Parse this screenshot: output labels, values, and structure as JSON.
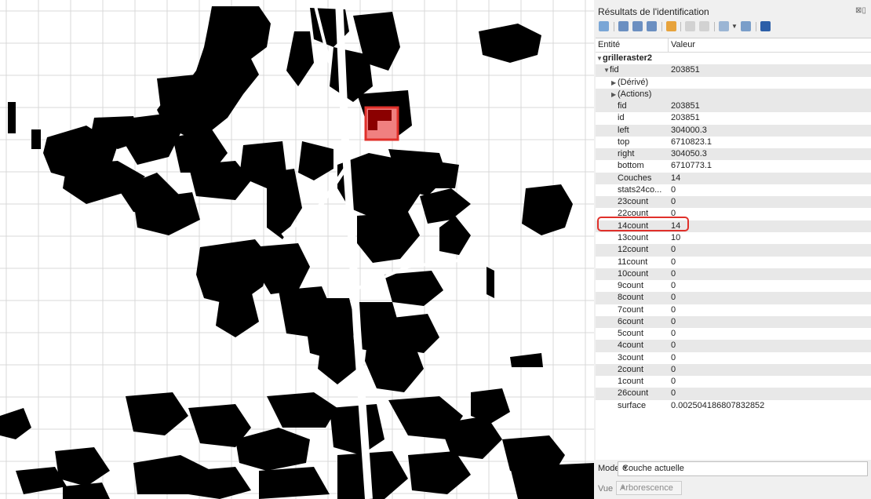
{
  "panel": {
    "title": "Résultats de l'identification",
    "toolbar_icons": [
      "expand-all-icon",
      "collapse-all-icon",
      "expand-new-icon",
      "collapse-new-icon",
      "highlight-icon",
      "copy-icon",
      "print-icon",
      "select-icon",
      "settings-icon",
      "help-icon"
    ],
    "columns": {
      "entity": "Entité",
      "value": "Valeur"
    },
    "layer_name": "grilleraster2",
    "feature": {
      "key": "fid",
      "value": "203851"
    },
    "sub_nodes": [
      "(Dérivé)",
      "(Actions)"
    ],
    "attributes": [
      {
        "key": "fid",
        "value": "203851"
      },
      {
        "key": "id",
        "value": "203851"
      },
      {
        "key": "left",
        "value": "304000.3"
      },
      {
        "key": "top",
        "value": "6710823.1"
      },
      {
        "key": "right",
        "value": "304050.3"
      },
      {
        "key": "bottom",
        "value": "6710773.1"
      },
      {
        "key": "Couches",
        "value": "14"
      },
      {
        "key": "stats24co...",
        "value": "0"
      },
      {
        "key": "23count",
        "value": "0"
      },
      {
        "key": "22count",
        "value": "0"
      },
      {
        "key": "14count",
        "value": "14"
      },
      {
        "key": "13count",
        "value": "10"
      },
      {
        "key": "12count",
        "value": "0"
      },
      {
        "key": "11count",
        "value": "0"
      },
      {
        "key": "10count",
        "value": "0"
      },
      {
        "key": "9count",
        "value": "0"
      },
      {
        "key": "8count",
        "value": "0"
      },
      {
        "key": "7count",
        "value": "0"
      },
      {
        "key": "6count",
        "value": "0"
      },
      {
        "key": "5count",
        "value": "0"
      },
      {
        "key": "4count",
        "value": "0"
      },
      {
        "key": "3count",
        "value": "0"
      },
      {
        "key": "2count",
        "value": "0"
      },
      {
        "key": "1count",
        "value": "0"
      },
      {
        "key": "26count",
        "value": "0"
      },
      {
        "key": "surface",
        "value": "0.002504186807832852"
      }
    ],
    "mode_label": "Mode",
    "mode_value": "Couche actuelle",
    "view_label": "Vue",
    "view_value": "Arborescence"
  },
  "colors": {
    "highlight": "#e0302a",
    "selected_cell": "#f08080",
    "raster_fill": "#000000",
    "grid": "#d9d9d9"
  }
}
